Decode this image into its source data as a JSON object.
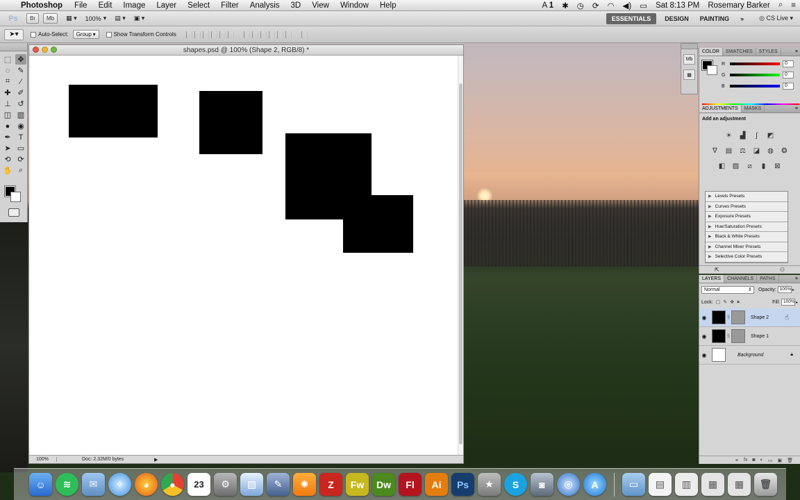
{
  "menubar": {
    "app_name": "Photoshop",
    "items": [
      "File",
      "Edit",
      "Image",
      "Layer",
      "Select",
      "Filter",
      "Analysis",
      "3D",
      "View",
      "Window",
      "Help"
    ],
    "status": {
      "adobe_badge": "1",
      "clock": "Sat 8:13 PM",
      "user": "Rosemary Barker"
    }
  },
  "appbar": {
    "logo": "Ps",
    "zoom": "100%",
    "workspaces": {
      "essentials": "ESSENTIALS",
      "design": "DESIGN",
      "painting": "PAINTING",
      "more": "»",
      "cs_live": "CS Live"
    }
  },
  "options": {
    "auto_select_label": "Auto-Select:",
    "auto_select_value": "Group",
    "transform_label": "Show Transform Controls"
  },
  "document": {
    "title": "shapes.psd @ 100% (Shape 2, RGB/8) *",
    "status_zoom": "100%",
    "status_doc": "Doc: 2.32M/0 bytes"
  },
  "color_panel": {
    "tabs": [
      "COLOR",
      "SWATCHES",
      "STYLES"
    ],
    "sliders": [
      {
        "label": "R",
        "value": "0"
      },
      {
        "label": "G",
        "value": "0"
      },
      {
        "label": "B",
        "value": "0"
      }
    ]
  },
  "adjustments_panel": {
    "tabs": [
      "ADJUSTMENTS",
      "MASKS"
    ],
    "title": "Add an adjustment",
    "presets": [
      "Levels Presets",
      "Curves Presets",
      "Exposure Presets",
      "Hue/Saturation Presets",
      "Black & White Presets",
      "Channel Mixer Presets",
      "Selective Color Presets"
    ]
  },
  "layers_panel": {
    "tabs": [
      "LAYERS",
      "CHANNELS",
      "PATHS"
    ],
    "blend_mode": "Normal",
    "opacity_label": "Opacity:",
    "opacity": "100%",
    "lock_label": "Lock:",
    "fill_label": "Fill:",
    "fill": "100%",
    "layers": [
      {
        "name": "Shape 2",
        "selected": true
      },
      {
        "name": "Shape 1",
        "selected": false
      },
      {
        "name": "Background",
        "selected": false
      }
    ]
  },
  "dock": {
    "apps": [
      "Finder",
      "Spotify",
      "Mail",
      "Safari",
      "Firefox",
      "Chrome",
      "Calendar",
      "System Preferences",
      "Preview",
      "Scripting",
      "SketchBook",
      "FileZilla",
      "Fireworks",
      "Dreamweaver",
      "Flash",
      "Illustrator",
      "Photoshop",
      "iMovie",
      "Skype",
      "FaceTime",
      "Airport",
      "App Store",
      "Folder",
      "Documents",
      "Downloads",
      "Stack",
      "Stack",
      "Trash"
    ],
    "calendar_day": "23"
  },
  "colors": {
    "selected_layer": "#c6d6ef",
    "canvas": "#ffffff",
    "shape": "#000000"
  }
}
